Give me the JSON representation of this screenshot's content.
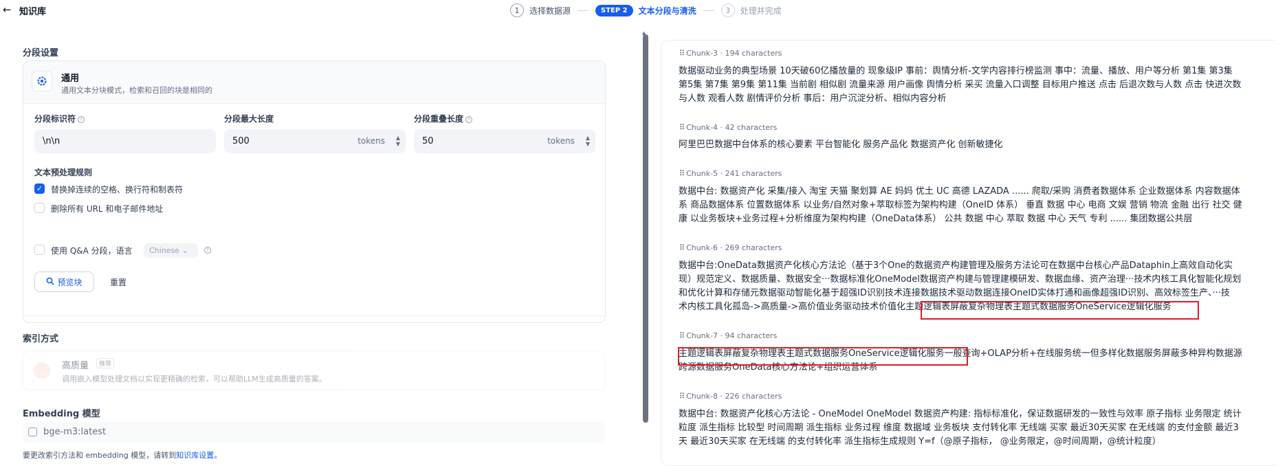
{
  "topbar": {
    "back_label": "←",
    "title": "知识库",
    "steps": [
      {
        "num": "1",
        "label": "选择数据源"
      },
      {
        "num": "STEP 2",
        "label": "文本分段与清洗"
      },
      {
        "num": "3",
        "label": "处理并完成"
      }
    ]
  },
  "segment": {
    "section_title": "分段设置",
    "mode_title": "通用",
    "mode_desc": "通用文本分块模式，检索和召回的块是相同的",
    "separator_label": "分段标识符",
    "separator_value": "\\n\\n",
    "max_len_label": "分段最大长度",
    "max_len_value": "500",
    "overlap_label": "分段重叠长度",
    "overlap_value": "50",
    "unit": "tokens",
    "rules_title": "文本预处理规则",
    "rule1": "替换掉连续的空格、换行符和制表符",
    "rule1_checked": true,
    "rule2": "删除所有 URL 和电子邮件地址",
    "rule2_checked": false,
    "qa_label": "使用 Q&A 分段，语言",
    "qa_language": "Chinese",
    "preview_button": "预览块",
    "reset_button": "重置"
  },
  "index": {
    "section_title": "索引方式",
    "hq_title": "高质量",
    "hq_badge": "推荐",
    "hq_desc": "调用嵌入模型处理文档以实现更精确的检索，可以帮助LLM生成高质量的答案。"
  },
  "embedding": {
    "section_title": "Embedding 模型",
    "model": "bge-m3:latest",
    "note_prefix": "要更改索引方法和 embedding 模型，请转到",
    "note_link": "知识库设置。"
  },
  "chunks": [
    {
      "id": "Chunk-3",
      "chars": "194 characters",
      "lines": [
        "数据驱动业务的典型场景 10天破60亿播放量的 现象级IP 事前：舆情分析-文学内容排行榜监测 事中：流量、播放、用户等分析 第1集 第3集",
        "第5集 第7集 第9集 第11集 当前剧 相似剧 流量来源 用户画像 舆情分析 采买 流量入口调整 目标用户推送 点击 后退次数与人数 点击 快进次数",
        "与人数 观看人数 剧情评价分析 事后：用户沉淀分析、相似内容分析"
      ]
    },
    {
      "id": "Chunk-4",
      "chars": "42 characters",
      "lines": [
        "阿里巴巴数据中台体系的核心要素 平台智能化 服务产品化 数据资产化 创新敏捷化"
      ]
    },
    {
      "id": "Chunk-5",
      "chars": "241 characters",
      "lines": [
        "数据中台: 数据资产化 采集/接入 淘宝 天猫 聚划算 AE 妈妈 优土 UC 高德 LAZADA ...... 爬取/采购 消费者数据体系 企业数据体系 内容数据体",
        "系 商品数据体系 位置数据体系 以业务/自然对象+萃取标签为架构构建（OneID 体系） 垂直 数据 中心 电商 文娱 营销 物流 金融 出行 社交 健",
        "康 以业务板块+业务过程+分析维度为架构构建（OneData体系） 公共 数据 中心 萃取 数据 中心 天气 专利 ...... 集团数据公共层"
      ]
    },
    {
      "id": "Chunk-6",
      "chars": "269 characters",
      "lines": [
        "数据中台:OneData数据资产化核心方法论（基于3个One的数据资产构建管理及服务方法论可在数据中台核心产品Dataphin上高效自动化实",
        "现）规范定义、数据质量、数据安全···数据标准化OneModel数据资产构建与管理建模研发、数据血缘、资产治理···技术内核工具化智能化规划",
        "和优化计算和存储元数据驱动智能化基于超强ID识别技术连接数据技术驱动数据连接OneID实体打通和画像超强ID识别、高效标签生产、···技",
        "术内核工具化孤岛->高质量->高价值业务驱动技术价值化主题逻辑表屏蔽复杂物理表主题式数据服务OneService逻辑化服务"
      ]
    },
    {
      "id": "Chunk-7",
      "chars": "94 characters",
      "lines": [
        "主题逻辑表屏蔽复杂物理表主题式数据服务OneService逻辑化服务一般查询+OLAP分析+在线服务统一但多样化数据服务屏蔽多种异构数据源",
        "跨源数据服务OneData核心方法论+组织运营体系"
      ]
    },
    {
      "id": "Chunk-8",
      "chars": "226 characters",
      "lines": [
        "数据中台: 数据资产化核心方法论 - OneModel OneModel 数据资产构建: 指标标准化，保证数据研发的一致性与效率 原子指标 业务限定 统计",
        "粒度 派生指标 比较型 时间周期 派生指标 业务过程 维度 数据域 业务板块 支付转化率 无线端 买家 最近30天买家 在无线端 的支付金额 最近3",
        "天 最近30天买家 在无线端 的支付转化率 派生指标生成规则 Y=f（@原子指标， @业务限定，@时间周期，@统计粒度）"
      ]
    }
  ]
}
